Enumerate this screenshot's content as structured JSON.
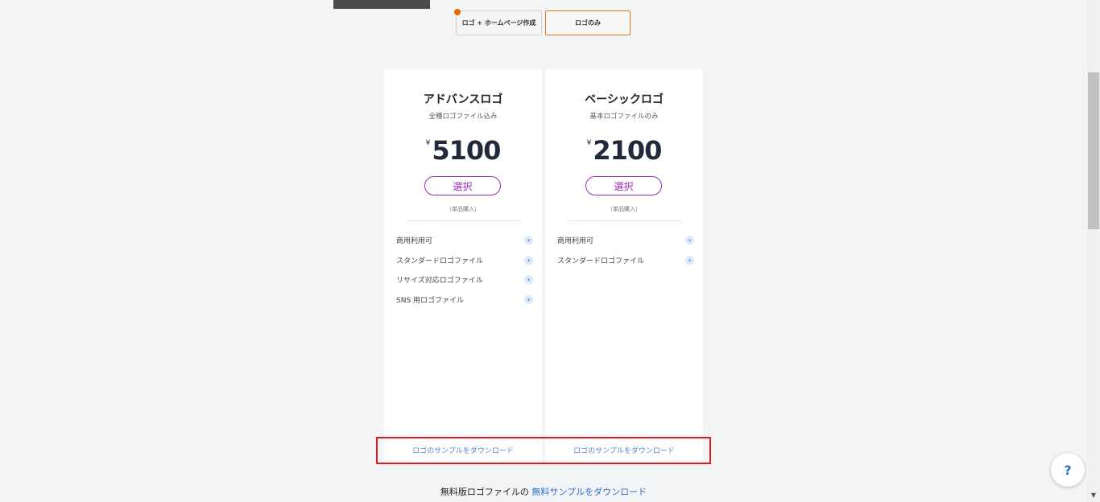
{
  "toggle": {
    "combo_label": "ロゴ + ホームページ作成",
    "logo_only_label": "ロゴのみ"
  },
  "cards": [
    {
      "title": "アドバンスロゴ",
      "subtitle": "全種ロゴファイル込み",
      "currency": "¥",
      "price": "5100",
      "select_label": "選択",
      "note": "（単品購入）",
      "features": [
        "商用利用可",
        "スタンダードロゴファイル",
        "リサイズ対応ロゴファイル",
        "SNS 用ロゴファイル"
      ],
      "download_label": "ロゴのサンプルをダウンロード"
    },
    {
      "title": "ベーシックロゴ",
      "subtitle": "基本ロゴファイルのみ",
      "currency": "¥",
      "price": "2100",
      "select_label": "選択",
      "note": "（単品購入）",
      "features": [
        "商用利用可",
        "スタンダードロゴファイル"
      ],
      "download_label": "ロゴのサンプルをダウンロード"
    }
  ],
  "footer": {
    "prefix": "無料版ロゴファイルの",
    "link": "無料サンプルをダウンロード"
  },
  "help": {
    "label": "?"
  },
  "icons": {
    "info": "chevron-right-icon",
    "scroll_down": "scroll-down-arrow-icon"
  },
  "colors": {
    "accent_purple": "#9b2bb5",
    "accent_orange": "#e07b16",
    "link_blue": "#2b6fc7",
    "highlight_red": "#e01919"
  }
}
